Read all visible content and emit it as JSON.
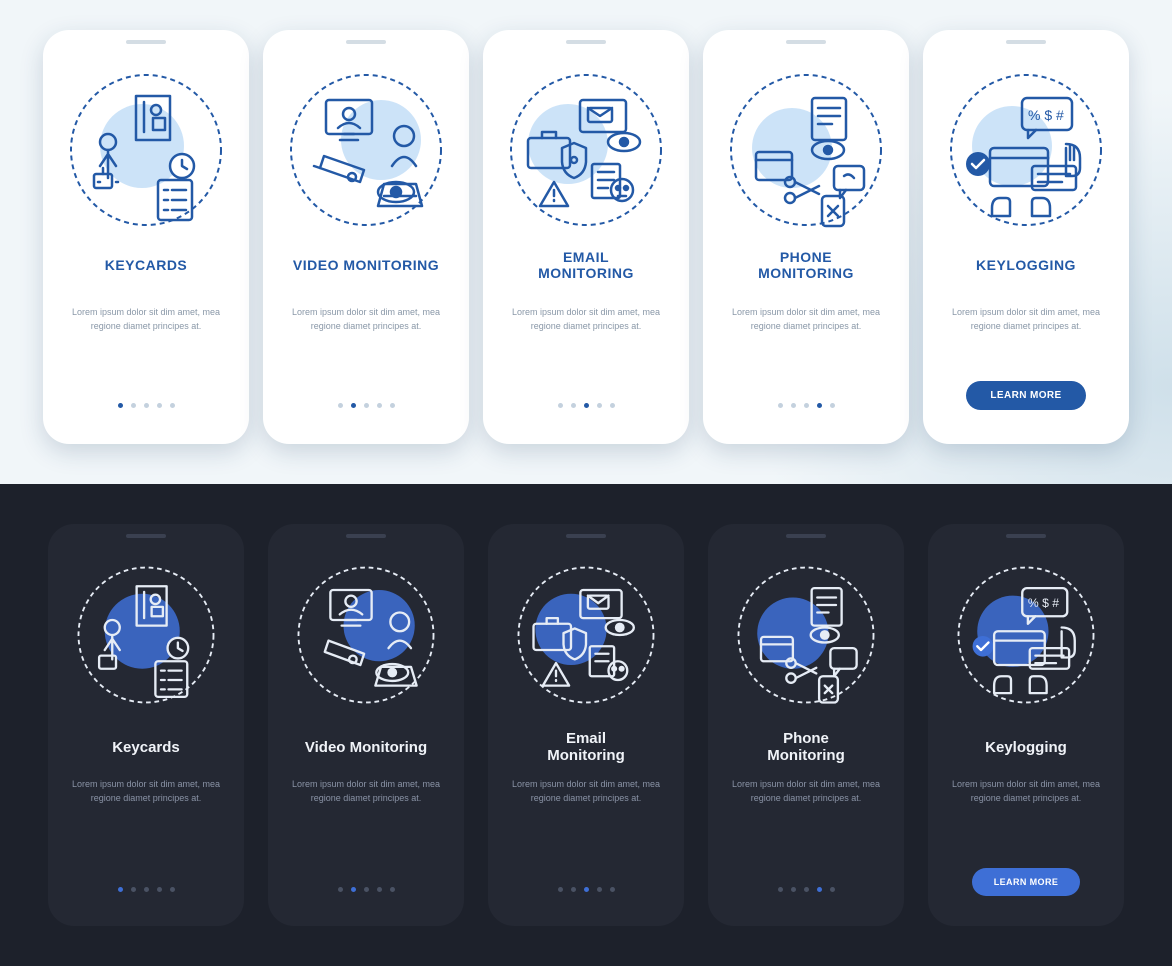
{
  "lorem": "Lorem ipsum dolor sit dim amet, mea regione diamet principes at.",
  "learn_more": "LEARN MORE",
  "light": {
    "cards": [
      {
        "title": "KEYCARDS",
        "active": 0
      },
      {
        "title": "VIDEO MONITORING",
        "active": 1
      },
      {
        "title": "EMAIL\nMONITORING",
        "active": 2
      },
      {
        "title": "PHONE\nMONITORING",
        "active": 3
      },
      {
        "title": "KEYLOGGING",
        "active": 4,
        "button": true
      }
    ],
    "dots_count": 5
  },
  "dark": {
    "cards": [
      {
        "title": "Keycards",
        "active": 0
      },
      {
        "title": "Video Monitoring",
        "active": 1
      },
      {
        "title": "Email\nMonitoring",
        "active": 2
      },
      {
        "title": "Phone\nMonitoring",
        "active": 3
      },
      {
        "title": "Keylogging",
        "active": 4,
        "button": true
      }
    ],
    "dots_count": 5
  }
}
